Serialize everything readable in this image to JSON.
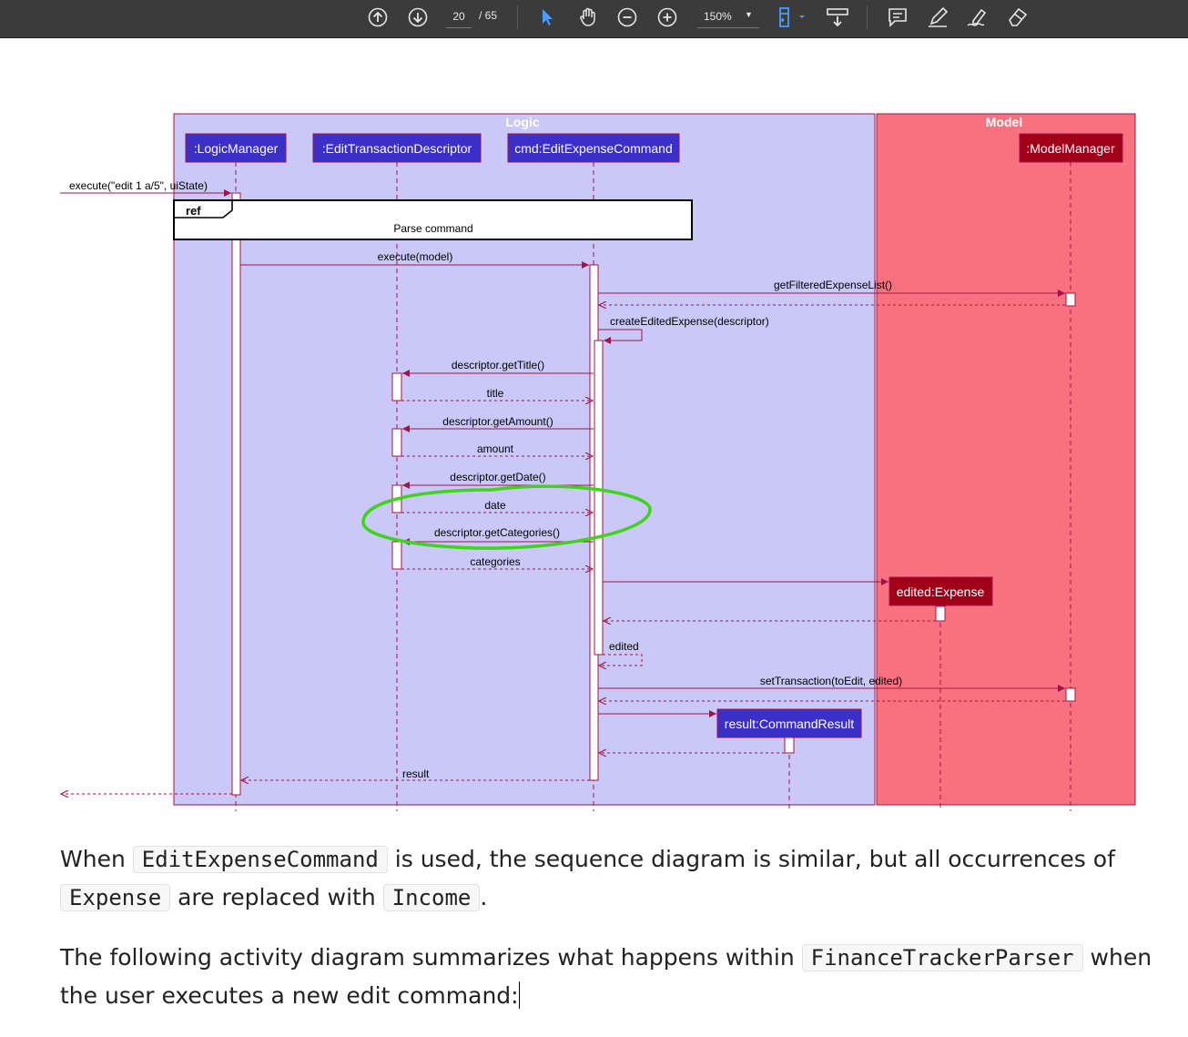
{
  "toolbar": {
    "page_current": "20",
    "page_total": "/ 65",
    "zoom": "150%",
    "icons": [
      "arrow-up-circle",
      "arrow-down-circle",
      "pointer",
      "hand",
      "zoom-out",
      "zoom-in",
      "fit-width",
      "scroll-mode",
      "comment",
      "highlight",
      "draw",
      "erase"
    ]
  },
  "diagram": {
    "frames": {
      "logic": "Logic",
      "model": "Model"
    },
    "participants": {
      "logic_manager": ":LogicManager",
      "descriptor": ":EditTransactionDescriptor",
      "command": "cmd:EditExpenseCommand",
      "model_manager": ":ModelManager",
      "edited_expense": "edited:Expense",
      "command_result": "result:CommandResult"
    },
    "ref": {
      "tag": "ref",
      "label": "Parse command"
    },
    "messages": {
      "execute_in": "execute(\"edit 1 a/5\", uiState)",
      "execute_model": "execute(model)",
      "get_filtered": "getFilteredExpenseList()",
      "create_edited": "createEditedExpense(descriptor)",
      "get_title": "descriptor.getTitle()",
      "title": "title",
      "get_amount": "descriptor.getAmount()",
      "amount": "amount",
      "get_date": "descriptor.getDate()",
      "date": "date",
      "get_categories": "descriptor.getCategories()",
      "categories": "categories",
      "edited": "edited",
      "set_transaction": "setTransaction(toEdit, edited)",
      "result": "result"
    },
    "colors": {
      "logic_bg": "#c9c8f7",
      "model_bg": "#f8717f",
      "frame_border": "#a5124a",
      "participant_blue": "#3a2fc7",
      "participant_red": "#a10019",
      "arrow": "#a5124a",
      "highlight": "#3fd31a"
    }
  },
  "body": {
    "p1": {
      "t1": "When ",
      "c1": "EditExpenseCommand",
      "t2": " is used, the sequence diagram is similar, but all occurrences of ",
      "c2": "Expense",
      "t3": " are replaced with ",
      "c3": "Income",
      "t4": "."
    },
    "p2": {
      "t1": "The following activity diagram summarizes what happens within ",
      "c1": "FinanceTrackerParser",
      "t2": " when the user executes a new edit command:"
    }
  }
}
